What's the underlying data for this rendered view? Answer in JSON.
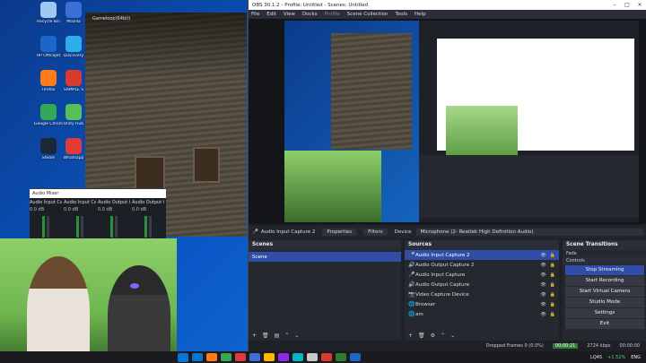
{
  "desktop": {
    "icons": [
      {
        "label": "Recycle Bin",
        "color": "#9fc7f0"
      },
      {
        "label": "Mozilla",
        "color": "#3a6fd8"
      },
      {
        "label": "HP OfficeJet",
        "color": "#1a66c9"
      },
      {
        "label": "Discovery",
        "color": "#2eaee8"
      },
      {
        "label": "Firefox",
        "color": "#ff7a18"
      },
      {
        "label": "SAMPLE S",
        "color": "#d83b2e"
      },
      {
        "label": "Google Chrome",
        "color": "#34a853"
      },
      {
        "label": "Unity Hub",
        "color": "#57c05d"
      },
      {
        "label": "Steam",
        "color": "#1b2838"
      },
      {
        "label": "Whatsapp",
        "color": "#e23a3a"
      }
    ]
  },
  "game": {
    "title": "Gameloop(64bit)"
  },
  "mini_mixer": {
    "header": "Audio Mixer",
    "channels": [
      {
        "name": "Audio Input Capture",
        "level": "0.0 dB"
      },
      {
        "name": "Audio Input Capture 2",
        "level": "0.0 dB"
      },
      {
        "name": "Audio Output Capture",
        "level": "0.0 dB"
      },
      {
        "name": "Audio Output Capture 2",
        "level": "0.0 dB"
      }
    ]
  },
  "obs": {
    "title": "OBS 30.1.2 - Profile: Untitled - Scenes: Untitled",
    "menu": [
      "File",
      "Edit",
      "View",
      "Docks",
      "Profile",
      "Scene Collection",
      "Tools",
      "Help"
    ],
    "source_bar": {
      "source": "Audio Input Capture 2",
      "properties": "Properties",
      "filters": "Filters",
      "device_label": "Device",
      "device_value": "Microphone (2- Realtek High Definition Audio)"
    },
    "scenes": {
      "title": "Scenes",
      "items": [
        "Scene"
      ]
    },
    "sources": {
      "title": "Sources",
      "items": [
        {
          "name": "Audio Input Capture 2",
          "icon": "mic-icon",
          "selected": true
        },
        {
          "name": "Audio Output Capture 2",
          "icon": "speaker-icon",
          "selected": false
        },
        {
          "name": "Audio Input Capture",
          "icon": "mic-icon",
          "selected": false
        },
        {
          "name": "Audio Output Capture",
          "icon": "speaker-icon",
          "selected": false
        },
        {
          "name": "Video Capture Device",
          "icon": "camera-icon",
          "selected": false
        },
        {
          "name": "Browser",
          "icon": "globe-icon",
          "selected": false
        },
        {
          "name": "am",
          "icon": "globe-icon",
          "selected": false
        }
      ]
    },
    "transitions": {
      "title": "Scene Transitions",
      "fade": "Fade",
      "controls": "Controls"
    },
    "controls": [
      {
        "label": "Stop Streaming",
        "active": true
      },
      {
        "label": "Start Recording",
        "active": false
      },
      {
        "label": "Start Virtual Camera",
        "active": false
      },
      {
        "label": "Studio Mode",
        "active": false
      },
      {
        "label": "Settings",
        "active": false
      },
      {
        "label": "Exit",
        "active": false
      }
    ],
    "status": {
      "dropped": "Dropped Frames 0 (0.0%)",
      "live_time": "00:00:21",
      "bitrate": "2724 kbps",
      "rec_time": "00:00:00"
    }
  },
  "taskbar": {
    "apps": [
      "#0078d4",
      "#ff7a18",
      "#34a853",
      "#e23a3a",
      "#3a6fd8",
      "#ffb900",
      "#8a2be2",
      "#00b7c3",
      "#c8c8c8",
      "#d83b2e",
      "#2e7d32",
      "#1a66c9"
    ],
    "tray": {
      "weather": "LQ45",
      "change": "+1.52%",
      "lang": "ENG"
    }
  }
}
